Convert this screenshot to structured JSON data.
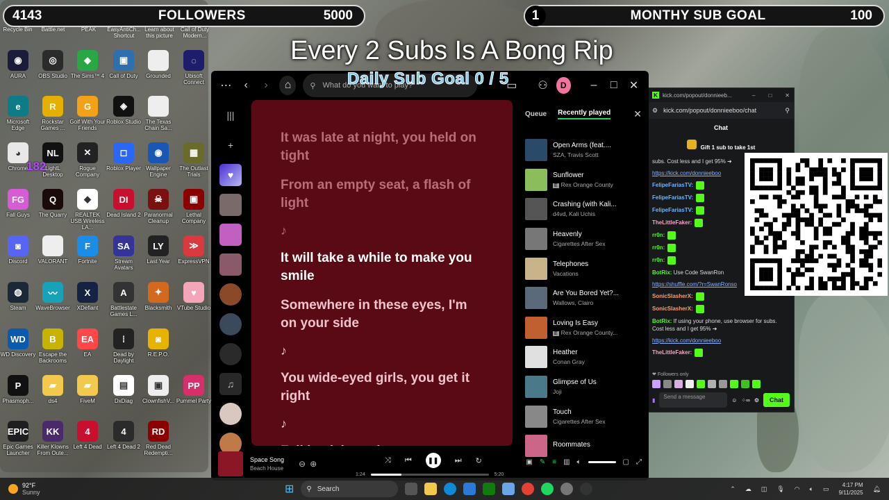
{
  "overlay": {
    "followers": {
      "count": "4143",
      "label": "FOLLOWERS",
      "goal": "5000"
    },
    "subs": {
      "count": "1",
      "label": "MONTHY SUB GOAL",
      "goal": "100"
    },
    "headline": "Every 2 Subs Is A Bong Rip",
    "daily_goal": "Daily Sub Goal  0 / 5"
  },
  "desktop": {
    "top_labels": [
      "Recycle Bin",
      "Battle.net",
      "PEAK",
      "EasyAntiCh... Shortcut",
      "Learn about this picture",
      "Call of Duty Modern..."
    ],
    "icons": [
      {
        "label": "AURA",
        "color": "#1b1b3a",
        "glyph": "◉"
      },
      {
        "label": "OBS Studio",
        "color": "#2b2b2b",
        "glyph": "◎"
      },
      {
        "label": "The Sims™ 4",
        "color": "#27a844",
        "glyph": "◆"
      },
      {
        "label": "Call of Duty",
        "color": "#2f6fae",
        "glyph": "▣"
      },
      {
        "label": "Grounded",
        "color": "#eeeeee",
        "glyph": ""
      },
      {
        "label": "Ubisoft Connect",
        "color": "#1d1d6b",
        "glyph": "◌"
      },
      {
        "label": "Microsoft Edge",
        "color": "#0e7c86",
        "glyph": "e"
      },
      {
        "label": "Rockstar Games ...",
        "color": "#e6b000",
        "glyph": "R"
      },
      {
        "label": "Golf With Your Friends",
        "color": "#f2a216",
        "glyph": "G"
      },
      {
        "label": "Roblox Studio",
        "color": "#111111",
        "glyph": "◈"
      },
      {
        "label": "The Texas Chain Sa...",
        "color": "#eeeeee",
        "glyph": ""
      },
      {
        "label": "",
        "color": "#00000000",
        "glyph": ""
      },
      {
        "label": "Chrome",
        "color": "#e8e8e8",
        "glyph": "◕"
      },
      {
        "label": "LightL Desktop",
        "color": "#111111",
        "glyph": "NL"
      },
      {
        "label": "Rogue Company",
        "color": "#222222",
        "glyph": "✕"
      },
      {
        "label": "Roblox Player",
        "color": "#2a67f5",
        "glyph": "◻"
      },
      {
        "label": "Wallpaper Engine",
        "color": "#1a56b3",
        "glyph": "◉"
      },
      {
        "label": "The Outlast Trials",
        "color": "#6a6a2a",
        "glyph": "▦"
      },
      {
        "label": "Fall Guys",
        "color": "#d45cd4",
        "glyph": "FG"
      },
      {
        "label": "The Quarry",
        "color": "#1a0a0a",
        "glyph": "Q"
      },
      {
        "label": "REALTEK USB Wireless LA...",
        "color": "#ffffff",
        "glyph": "◆"
      },
      {
        "label": "Dead Island 2",
        "color": "#c8102e",
        "glyph": "DI"
      },
      {
        "label": "Paranormal Cleanup",
        "color": "#7a1010",
        "glyph": "☠"
      },
      {
        "label": "Lethal Company",
        "color": "#8b0000",
        "glyph": "▣"
      },
      {
        "label": "Discord",
        "color": "#5865f2",
        "glyph": "◙"
      },
      {
        "label": "VALORANT",
        "color": "#eeeeee",
        "glyph": ""
      },
      {
        "label": "Fortnite",
        "color": "#1a8ee6",
        "glyph": "F"
      },
      {
        "label": "Stream Avatars",
        "color": "#333399",
        "glyph": "SA"
      },
      {
        "label": "Last Year",
        "color": "#222222",
        "glyph": "LY"
      },
      {
        "label": "ExpressVPN",
        "color": "#da3940",
        "glyph": "≫"
      },
      {
        "label": "Steam",
        "color": "#1b2838",
        "glyph": "◍"
      },
      {
        "label": "WaveBrowser",
        "color": "#17a2b8",
        "glyph": "〰"
      },
      {
        "label": "XDefiant",
        "color": "#152244",
        "glyph": "X"
      },
      {
        "label": "Battlestate Games L...",
        "color": "#333333",
        "glyph": "A"
      },
      {
        "label": "Blacksmith",
        "color": "#d2691e",
        "glyph": "✦"
      },
      {
        "label": "VTube Studio",
        "color": "#f4a6b8",
        "glyph": "♥"
      },
      {
        "label": "WD Discovery",
        "color": "#0a5aad",
        "glyph": "WD"
      },
      {
        "label": "Escape the Backrooms",
        "color": "#c8b400",
        "glyph": "B"
      },
      {
        "label": "EA",
        "color": "#ff4747",
        "glyph": "EA"
      },
      {
        "label": "Dead by Daylight",
        "color": "#222222",
        "glyph": "⁞"
      },
      {
        "label": "R.E.P.O.",
        "color": "#e6b400",
        "glyph": "◙"
      },
      {
        "label": "",
        "color": "#00000000",
        "glyph": ""
      },
      {
        "label": "Phasmoph...",
        "color": "#111111",
        "glyph": "P"
      },
      {
        "label": "ds4",
        "color": "#f2c94c",
        "glyph": "▰"
      },
      {
        "label": "FiveM",
        "color": "#f2c94c",
        "glyph": "▰"
      },
      {
        "label": "DxDiag",
        "color": "#ffffff",
        "glyph": "▤"
      },
      {
        "label": "ClownfishV...",
        "color": "#eeeeee",
        "glyph": "▣"
      },
      {
        "label": "Pummel Party",
        "color": "#d62f6a",
        "glyph": "PP"
      },
      {
        "label": "Epic Games Launcher",
        "color": "#1f1f1f",
        "glyph": "EPIC"
      },
      {
        "label": "Killer Klowns From Oute...",
        "color": "#4a2a6a",
        "glyph": "KK"
      },
      {
        "label": "Left 4 Dead",
        "color": "#c8102e",
        "glyph": "4"
      },
      {
        "label": "Left 4 Dead 2",
        "color": "#2b2b2b",
        "glyph": "4"
      },
      {
        "label": "Red Dead Redempti...",
        "color": "#8b0000",
        "glyph": "RD"
      },
      {
        "label": "",
        "color": "#00000000",
        "glyph": ""
      }
    ],
    "tag_182": "182"
  },
  "spotify": {
    "search_placeholder": "What do you want to play?",
    "avatar": "D",
    "lyrics": [
      {
        "text": "It was late at night, you held on tight",
        "state": "dim"
      },
      {
        "text": "From an empty seat, a flash of light",
        "state": "dim"
      },
      {
        "text": "♪",
        "state": "note-dim"
      },
      {
        "text": "It will take a while to make you smile",
        "state": "act"
      },
      {
        "text": "Somewhere in these eyes, I'm on your side",
        "state": "soon"
      },
      {
        "text": "♪",
        "state": "note"
      },
      {
        "text": "You wide-eyed girls, you get it right",
        "state": "soon"
      },
      {
        "text": "♪",
        "state": "note"
      },
      {
        "text": "Fall back into place",
        "state": "soon"
      }
    ],
    "queue": {
      "tab_queue": "Queue",
      "tab_recent": "Recently played",
      "tracks": [
        {
          "title": "Open Arms (feat....",
          "artist": "SZA, Travis Scott",
          "explicit": false,
          "color": "#2a4a6a"
        },
        {
          "title": "Sunflower",
          "artist": "Rex Orange County",
          "explicit": true,
          "color": "#8bbd5a"
        },
        {
          "title": "Crashing (with Kali...",
          "artist": "d4vd, Kali Uchis",
          "explicit": false,
          "color": "#555555"
        },
        {
          "title": "Heavenly",
          "artist": "Cigarettes After Sex",
          "explicit": false,
          "color": "#777777"
        },
        {
          "title": "Telephones",
          "artist": "Vacations",
          "explicit": false,
          "color": "#c9b48a"
        },
        {
          "title": "Are You Bored Yet?...",
          "artist": "Wallows, Clairo",
          "explicit": false,
          "color": "#5a6a7a"
        },
        {
          "title": "Loving Is Easy",
          "artist": "Rex Orange County...",
          "explicit": true,
          "color": "#c06030"
        },
        {
          "title": "Heather",
          "artist": "Conan Gray",
          "explicit": false,
          "color": "#e0e0e0"
        },
        {
          "title": "Glimpse of Us",
          "artist": "Joji",
          "explicit": false,
          "color": "#4a7a8a"
        },
        {
          "title": "Touch",
          "artist": "Cigarettes After Sex",
          "explicit": false,
          "color": "#888888"
        },
        {
          "title": "Roommates",
          "artist": "",
          "explicit": false,
          "color": "#cc6688"
        }
      ]
    },
    "player": {
      "title": "Space Song",
      "artist": "Beach House",
      "elapsed": "1:24",
      "duration": "5:20",
      "progress": 0.26
    }
  },
  "kick": {
    "window_title": "kick.com/popout/donnieeb...",
    "url": "kick.com/popout/donnieeboo/chat",
    "header": "Chat",
    "gift": "Gift 1 sub to take 1st",
    "messages": [
      {
        "name": "",
        "text": "subs. Cost less and I get 95% ➜",
        "color": "#ddd"
      },
      {
        "name": "",
        "text": "https://kick.com/donnieeboo",
        "color": "#8ab4ff"
      },
      {
        "name": "FelipeFariasTV:",
        "text": "",
        "color": "#6cb6ff"
      },
      {
        "name": "FelipeFariasTV:",
        "text": "",
        "color": "#6cb6ff"
      },
      {
        "name": "FelipeFariasTV:",
        "text": "",
        "color": "#6cb6ff"
      },
      {
        "name": "TheLittleFaker:",
        "text": "",
        "color": "#f5a3c7"
      },
      {
        "name": "rr0n:",
        "text": "",
        "color": "#53fc18"
      },
      {
        "name": "rr0n:",
        "text": "",
        "color": "#53fc18"
      },
      {
        "name": "rr0n:",
        "text": "",
        "color": "#53fc18"
      },
      {
        "name": "BotRix:",
        "text": "Use Code SwanRon",
        "color": "#53fc18"
      },
      {
        "name": "",
        "text": "https://shuffle.com/?r=SwanRonso",
        "color": "#8ab4ff"
      },
      {
        "name": "SonicSlasherX:",
        "text": "",
        "color": "#ff9f6b"
      },
      {
        "name": "SonicSlasherX:",
        "text": "",
        "color": "#ff9f6b"
      },
      {
        "name": "BotRix:",
        "text": "If using your phone, use browser for subs. Cost less and I get 95% ➜",
        "color": "#53fc18"
      },
      {
        "name": "",
        "text": "https://kick.com/donnieeboo",
        "color": "#8ab4ff"
      },
      {
        "name": "TheLittleFaker:",
        "text": "",
        "color": "#f5a3c7"
      }
    ],
    "followers_only": "Followers only",
    "input_placeholder": "Send a message",
    "chat_button": "Chat"
  },
  "taskbar": {
    "weather_temp": "92°F",
    "weather_desc": "Sunny",
    "search": "Search",
    "time": "4:17 PM",
    "date": "9/11/2025"
  }
}
